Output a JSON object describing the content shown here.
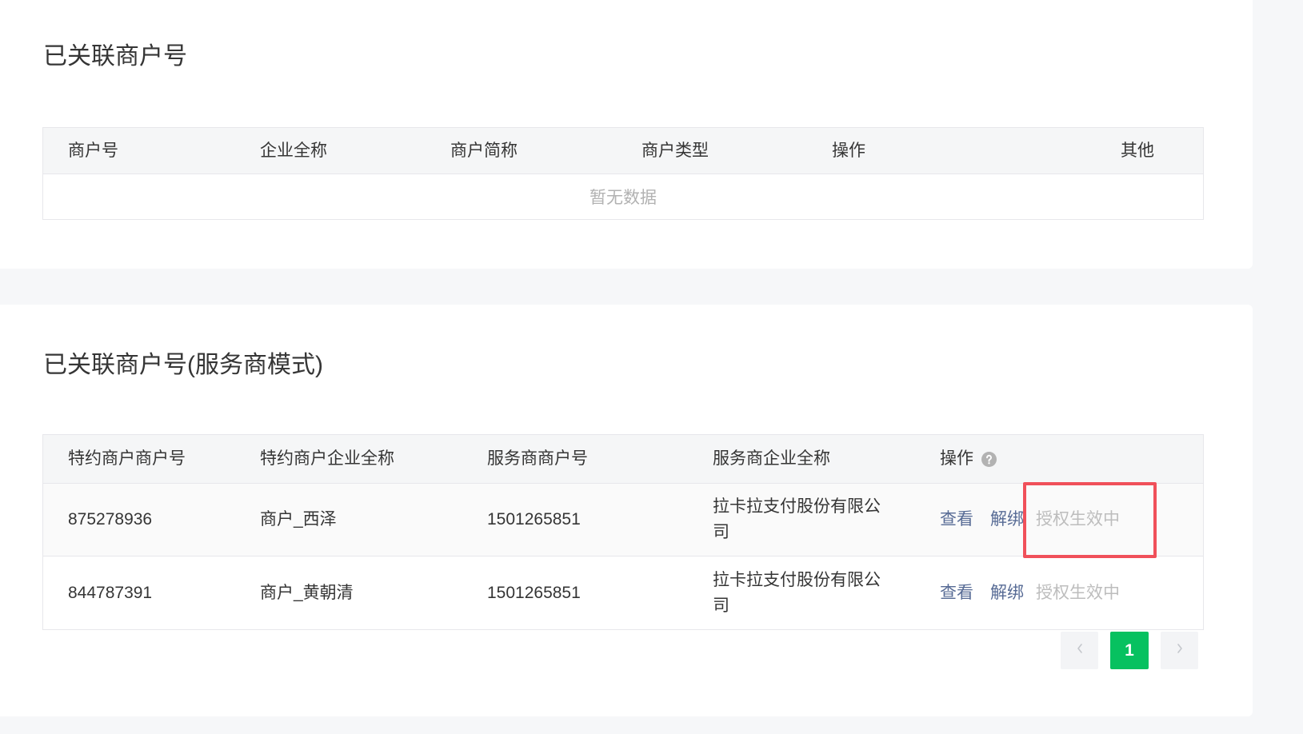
{
  "colors": {
    "page_background": "#f6f7f9",
    "card_background": "#ffffff",
    "table_header_background": "#f5f6f7",
    "table_border": "#e7e7eb",
    "row_hover_background": "#fafafa",
    "text_primary": "#353535",
    "text_placeholder": "#b2b2b2",
    "link": "#576b95",
    "status_disabled": "#bdbdbd",
    "pagination_active": "#07c160",
    "pager_background": "#f3f4f6",
    "highlight_outline": "#f0505a"
  },
  "section_linked": {
    "title": "已关联商户号",
    "columns": [
      "商户号",
      "企业全称",
      "商户简称",
      "商户类型",
      "操作",
      "其他"
    ],
    "empty_text": "暂无数据"
  },
  "section_service_provider": {
    "title": "已关联商户号(服务商模式)",
    "columns": [
      "特约商户商户号",
      "特约商户企业全称",
      "服务商商户号",
      "服务商企业全称",
      "操作"
    ],
    "operation_help_icon": "question-circle-icon",
    "rows": [
      {
        "sub_merchant_id": "875278936",
        "sub_merchant_company": "商户_西泽",
        "service_provider_merchant_id": "1501265851",
        "service_provider_company": "拉卡拉支付股份有限公司",
        "action_view": "查看",
        "action_unbind": "解绑",
        "authorization_status": "授权生效中"
      },
      {
        "sub_merchant_id": "844787391",
        "sub_merchant_company": "商户_黄朝清",
        "service_provider_merchant_id": "1501265851",
        "service_provider_company": "拉卡拉支付股份有限公司",
        "action_view": "查看",
        "action_unbind": "解绑",
        "authorization_status": "授权生效中"
      }
    ]
  },
  "pagination": {
    "prev_icon": "chevron-left-icon",
    "next_icon": "chevron-right-icon",
    "current_page": "1"
  }
}
